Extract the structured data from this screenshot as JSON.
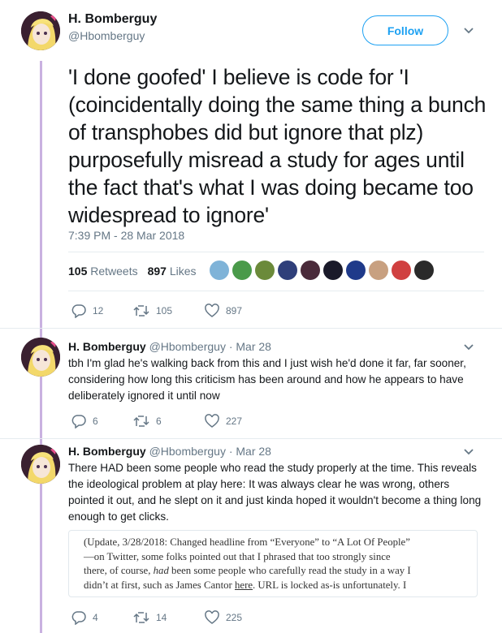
{
  "main_tweet": {
    "display_name": "H. Bomberguy",
    "handle": "@Hbomberguy",
    "follow_label": "Follow",
    "text": "'I done goofed' I believe is code for 'I (coincidentally doing the same thing a bunch of transphobes did but ignore that plz) purposefully misread a study for ages until the fact that's what I was doing became too widespread to ignore'",
    "timestamp": "7:39 PM - 28 Mar 2018",
    "retweets_count": "105",
    "retweets_label": "Retweets",
    "likes_count": "897",
    "likes_label": "Likes",
    "actions": {
      "replies": "12",
      "retweets": "105",
      "likes": "897"
    }
  },
  "replies": [
    {
      "display_name": "H. Bomberguy",
      "meta": "@Hbomberguy · Mar 28",
      "text": "tbh I'm glad he's walking back from this and I just wish he'd done it far, far sooner, considering how long this criticism has been around and how he appears to have deliberately ignored it until now",
      "actions": {
        "replies": "6",
        "retweets": "6",
        "likes": "227"
      }
    },
    {
      "display_name": "H. Bomberguy",
      "meta": "@Hbomberguy · Mar 28",
      "text": "There HAD been some people who read the study properly at the time. This reveals the ideological problem at play here: It was always clear he was wrong, others pointed it out, and he slept on it and just kinda hoped it wouldn't become a thing long enough to get clicks.",
      "quote": {
        "line1": "(Update, 3/28/2018: Changed headline from “Everyone” to “A Lot Of People”",
        "line2": "—on Twitter, some folks pointed out that I phrased that too strongly since",
        "line3_pre": "there, of course, ",
        "line3_em": "had",
        "line3_post": " been some people who carefully read the study in a way I",
        "line4_pre": "didn’t at first, such as James Cantor ",
        "line4_link": "here",
        "line4_post": ". URL is locked as-is unfortunately. I"
      },
      "actions": {
        "replies": "4",
        "retweets": "14",
        "likes": "225"
      }
    }
  ],
  "colors": {
    "accent": "#1da1f2",
    "thread_line": "#c9b1e0",
    "muted": "#657786"
  }
}
